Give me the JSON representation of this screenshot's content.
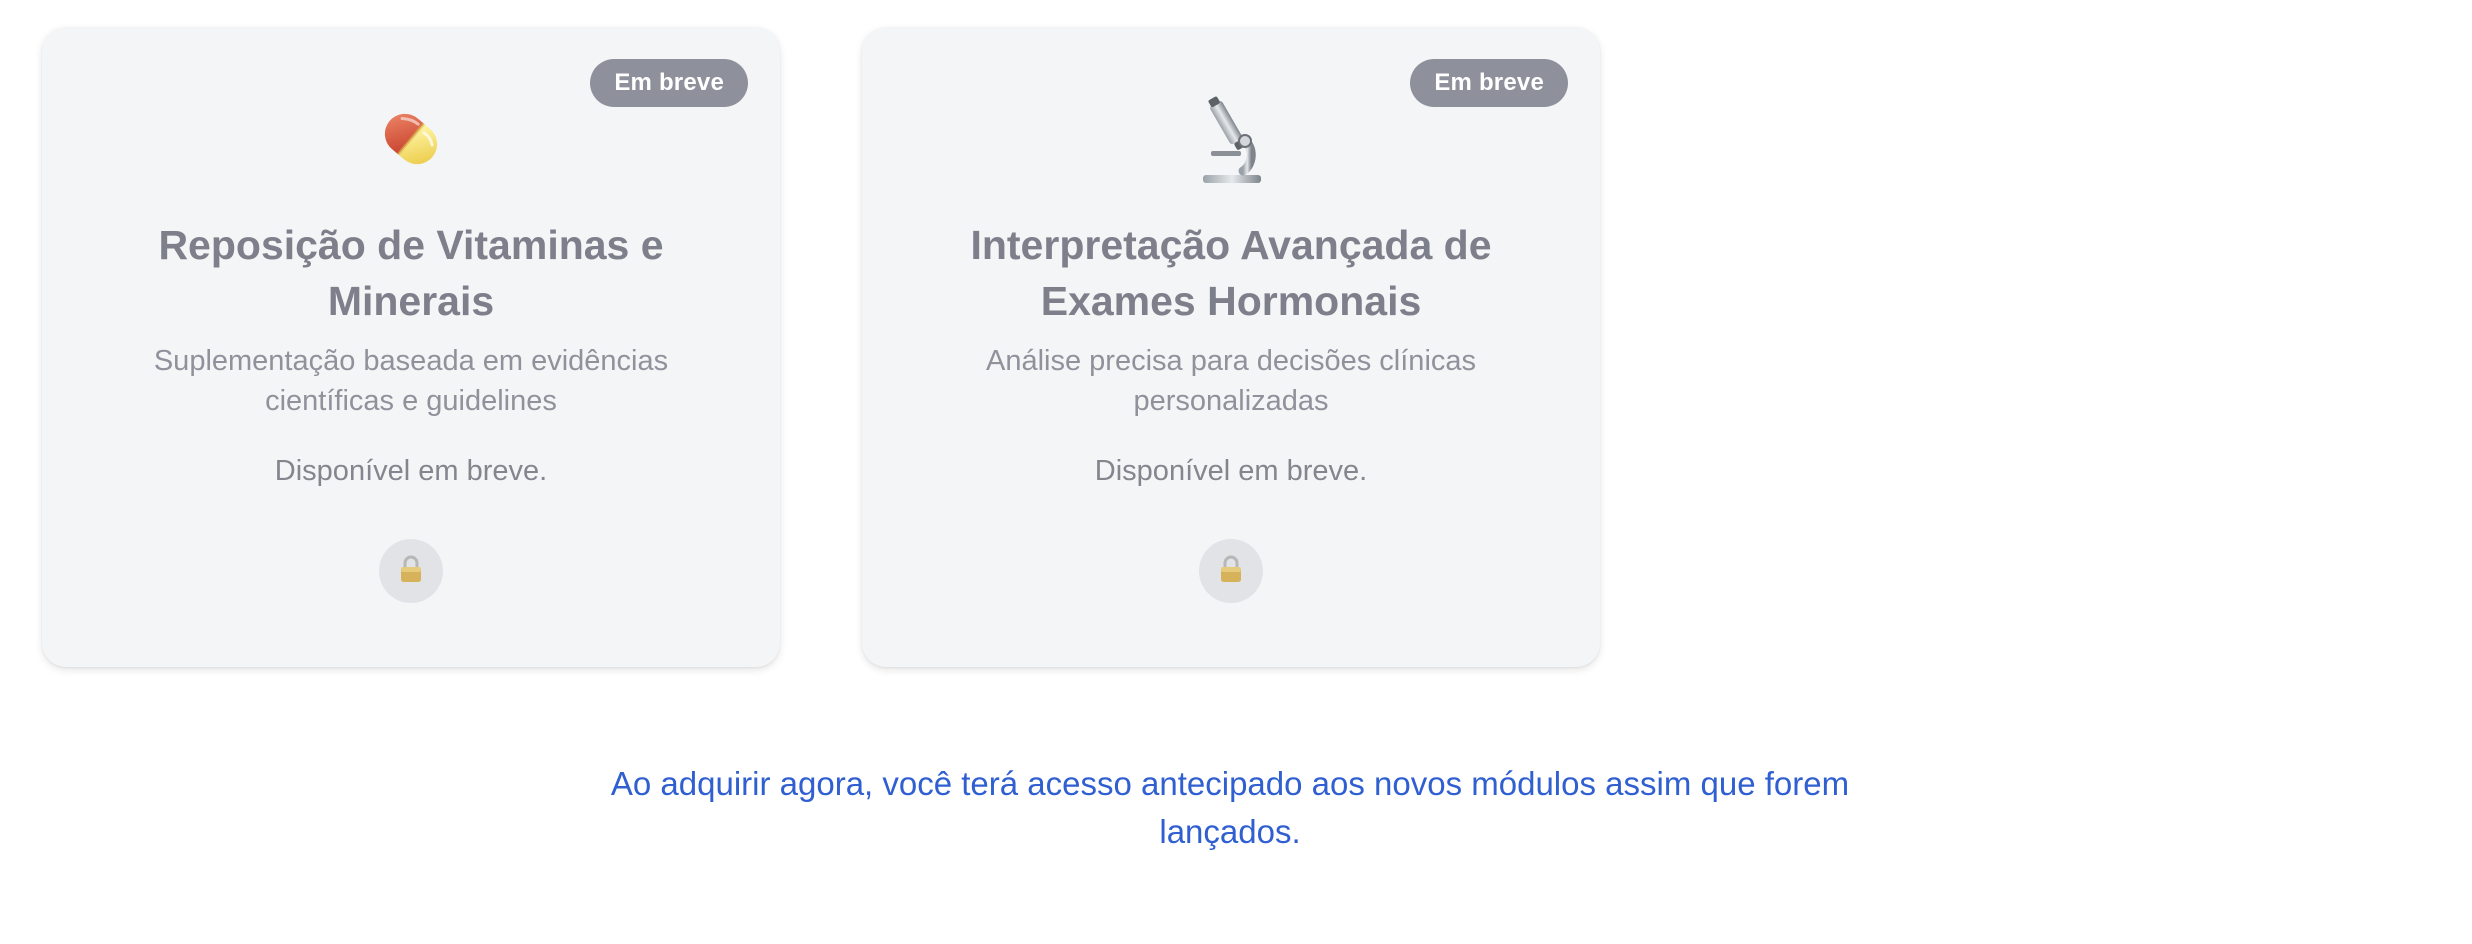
{
  "cards": [
    {
      "badge": "Em breve",
      "icon": "pill-icon",
      "title": "Reposição de Vitaminas e Minerais",
      "description": "Suplementação baseada em evidências científicas e guidelines",
      "status": "Disponível em breve.",
      "lock_icon": "lock-icon"
    },
    {
      "badge": "Em breve",
      "icon": "microscope-icon",
      "title": "Interpretação Avançada de Exames Hormonais",
      "description": "Análise precisa para decisões clínicas personalizadas",
      "status": "Disponível em breve.",
      "lock_icon": "lock-icon"
    }
  ],
  "footer": {
    "note": "Ao adquirir agora, você terá acesso antecipado aos novos módulos assim que forem lançados."
  },
  "colors": {
    "card_background": "#f4f5f7",
    "badge_background": "#8e919b",
    "title": "#7d808a",
    "footer_note": "#2f5fd0"
  }
}
